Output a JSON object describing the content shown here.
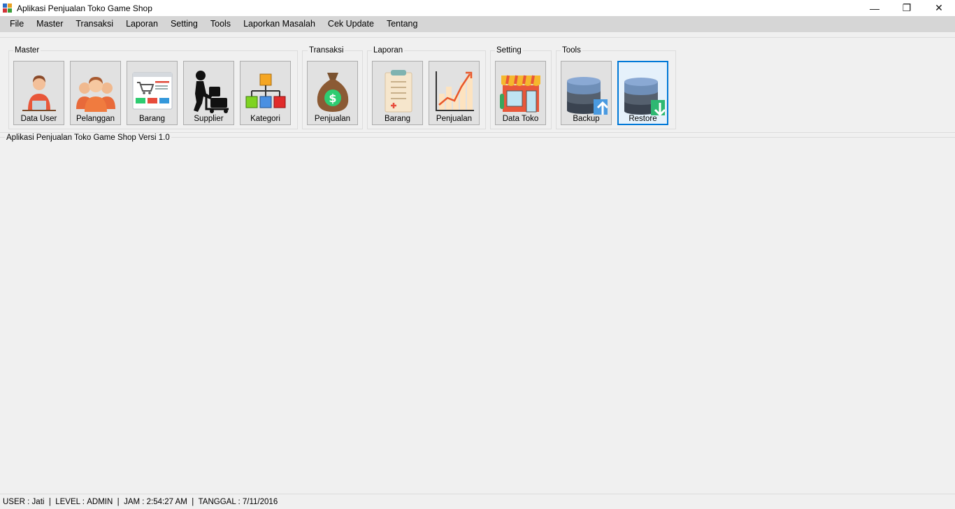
{
  "window": {
    "title": "Aplikasi Penjualan Toko Game Shop",
    "controls": {
      "minimize": "—",
      "restore": "❐",
      "close": "✕"
    }
  },
  "menu": [
    "File",
    "Master",
    "Transaksi",
    "Laporan",
    "Setting",
    "Tools",
    "Laporkan Masalah",
    "Cek Update",
    "Tentang"
  ],
  "toolbar": {
    "groups": [
      {
        "label": "Master",
        "buttons": [
          "Data User",
          "Pelanggan",
          "Barang",
          "Supplier",
          "Kategori"
        ]
      },
      {
        "label": "Transaksi",
        "buttons": [
          "Penjualan"
        ]
      },
      {
        "label": "Laporan",
        "buttons": [
          "Barang",
          "Penjualan"
        ]
      },
      {
        "label": "Setting",
        "buttons": [
          "Data Toko"
        ]
      },
      {
        "label": "Tools",
        "buttons": [
          "Backup",
          "Restore"
        ]
      }
    ],
    "icons": [
      "user-at-laptop-icon",
      "customers-group-icon",
      "shopping-web-icon",
      "supplier-cart-icon",
      "category-tree-icon",
      "money-bag-icon",
      "clipboard-report-icon",
      "sales-chart-icon",
      "store-front-icon",
      "database-upload-icon",
      "database-download-icon"
    ],
    "selected": "Restore",
    "accent": "#0078d7",
    "currency_symbol": "$"
  },
  "main": {
    "caption": "Aplikasi Penjualan Toko Game Shop Versi 1.0"
  },
  "status": {
    "user_label": "USER :",
    "user": "Jati",
    "level_label": "LEVEL :",
    "level": "ADMIN",
    "time_label": "JAM :",
    "time": "2:54:27 AM",
    "date_label": "TANGGAL :",
    "date": "7/11/2016",
    "sep": "|"
  }
}
